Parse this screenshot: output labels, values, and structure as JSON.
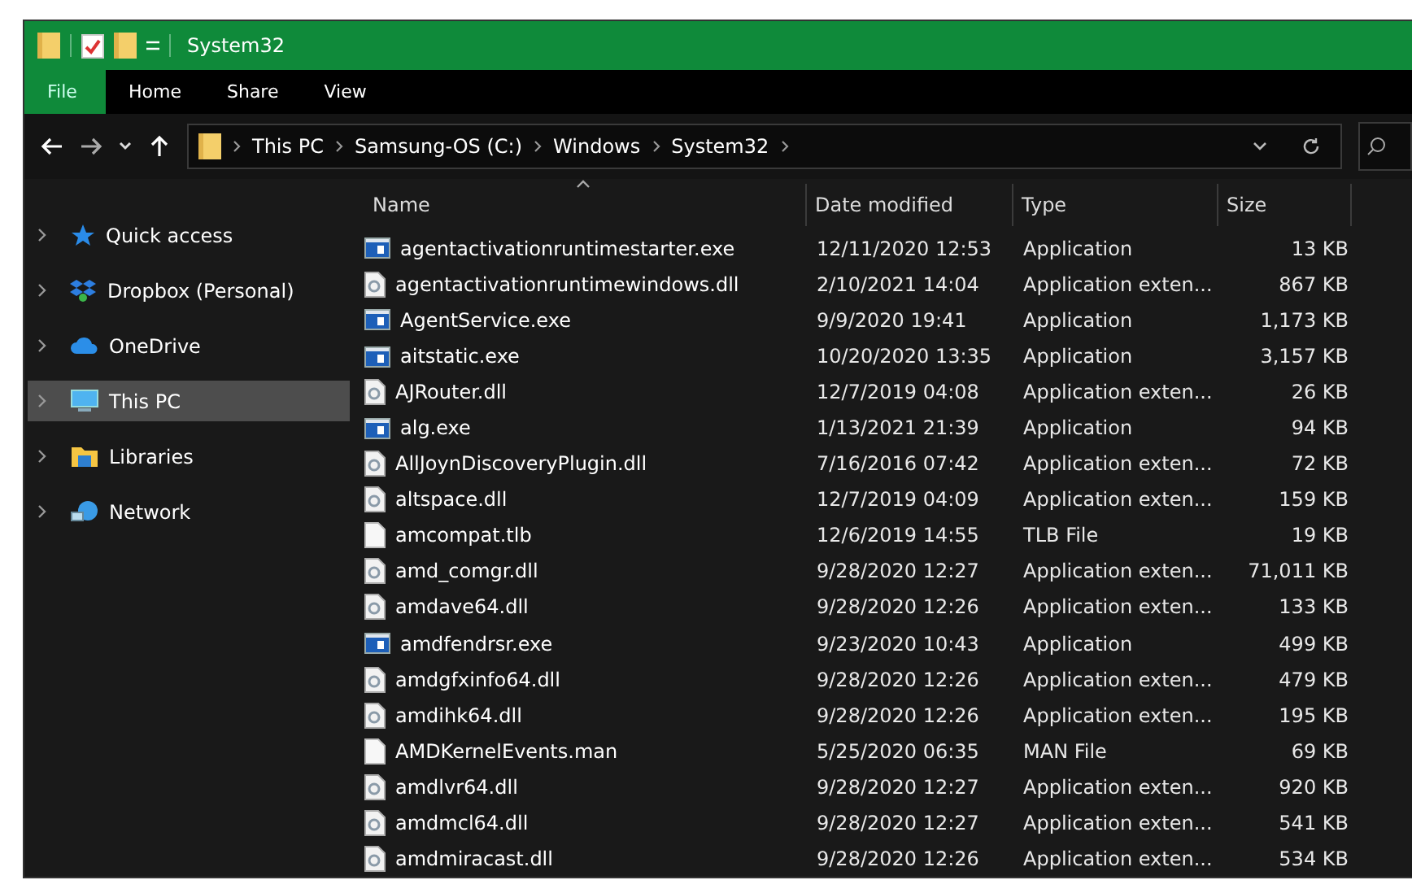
{
  "window": {
    "title": "System32"
  },
  "ribbon_tabs": [
    {
      "label": "File",
      "selected": true
    },
    {
      "label": "Home",
      "selected": false
    },
    {
      "label": "Share",
      "selected": false
    },
    {
      "label": "View",
      "selected": false
    }
  ],
  "address": {
    "path": [
      "This PC",
      "Samsung-OS (C:)",
      "Windows",
      "System32"
    ]
  },
  "sidebar": {
    "items": [
      {
        "label": "Quick access",
        "kind": "star",
        "selected": false
      },
      {
        "label": "Dropbox (Personal)",
        "kind": "dropbox",
        "selected": false
      },
      {
        "label": "OneDrive",
        "kind": "cloud",
        "selected": false
      },
      {
        "label": "This PC",
        "kind": "pc",
        "selected": true
      },
      {
        "label": "Libraries",
        "kind": "library",
        "selected": false
      },
      {
        "label": "Network",
        "kind": "network",
        "selected": false
      }
    ]
  },
  "table": {
    "columns": [
      "Name",
      "Date modified",
      "Type",
      "Size"
    ],
    "rows": [
      {
        "kind": "exe",
        "name": "agentactivationruntimestarter.exe",
        "date": "12/11/2020 12:53",
        "type": "Application",
        "size": "13 KB"
      },
      {
        "kind": "dll",
        "name": "agentactivationruntimewindows.dll",
        "date": "2/10/2021 14:04",
        "type": "Application exten...",
        "size": "867 KB"
      },
      {
        "kind": "exe",
        "name": "AgentService.exe",
        "date": "9/9/2020 19:41",
        "type": "Application",
        "size": "1,173 KB"
      },
      {
        "kind": "exe",
        "name": "aitstatic.exe",
        "date": "10/20/2020 13:35",
        "type": "Application",
        "size": "3,157 KB"
      },
      {
        "kind": "dll",
        "name": "AJRouter.dll",
        "date": "12/7/2019 04:08",
        "type": "Application exten...",
        "size": "26 KB"
      },
      {
        "kind": "exe",
        "name": "alg.exe",
        "date": "1/13/2021 21:39",
        "type": "Application",
        "size": "94 KB"
      },
      {
        "kind": "dll",
        "name": "AllJoynDiscoveryPlugin.dll",
        "date": "7/16/2016 07:42",
        "type": "Application exten...",
        "size": "72 KB"
      },
      {
        "kind": "dll",
        "name": "altspace.dll",
        "date": "12/7/2019 04:09",
        "type": "Application exten...",
        "size": "159 KB"
      },
      {
        "kind": "file",
        "name": "amcompat.tlb",
        "date": "12/6/2019 14:55",
        "type": "TLB File",
        "size": "19 KB"
      },
      {
        "kind": "dll",
        "name": "amd_comgr.dll",
        "date": "9/28/2020 12:27",
        "type": "Application exten...",
        "size": "71,011 KB"
      },
      {
        "kind": "dll",
        "name": "amdave64.dll",
        "date": "9/28/2020 12:26",
        "type": "Application exten...",
        "size": "133 KB"
      },
      {
        "kind": "exe",
        "name": "amdfendrsr.exe",
        "date": "9/23/2020 10:43",
        "type": "Application",
        "size": "499 KB"
      },
      {
        "kind": "dll",
        "name": "amdgfxinfo64.dll",
        "date": "9/28/2020 12:26",
        "type": "Application exten...",
        "size": "479 KB"
      },
      {
        "kind": "dll",
        "name": "amdihk64.dll",
        "date": "9/28/2020 12:26",
        "type": "Application exten...",
        "size": "195 KB"
      },
      {
        "kind": "file",
        "name": "AMDKernelEvents.man",
        "date": "5/25/2020 06:35",
        "type": "MAN File",
        "size": "69 KB"
      },
      {
        "kind": "dll",
        "name": "amdlvr64.dll",
        "date": "9/28/2020 12:27",
        "type": "Application exten...",
        "size": "920 KB"
      },
      {
        "kind": "dll",
        "name": "amdmcl64.dll",
        "date": "9/28/2020 12:27",
        "type": "Application exten...",
        "size": "541 KB"
      },
      {
        "kind": "dll",
        "name": "amdmiracast.dll",
        "date": "9/28/2020 12:26",
        "type": "Application exten...",
        "size": "534 KB"
      }
    ]
  }
}
